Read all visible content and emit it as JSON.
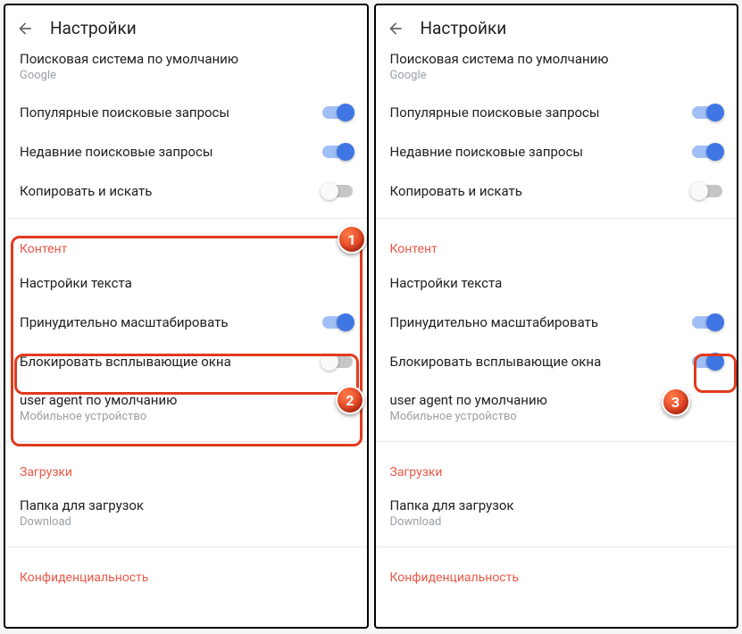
{
  "toolbar": {
    "title": "Настройки"
  },
  "search_engine": {
    "title": "Поисковая система по умолчанию",
    "value": "Google"
  },
  "popular_queries": {
    "label": "Популярные поисковые запросы",
    "on": true
  },
  "recent_queries": {
    "label": "Недавние поисковые запросы",
    "on": true
  },
  "copy_search": {
    "label": "Копировать и искать",
    "on": false
  },
  "section_content": "Контент",
  "text_settings": {
    "label": "Настройки текста"
  },
  "force_zoom": {
    "label": "Принудительно масштабировать",
    "on": true
  },
  "block_popups": {
    "label": "Блокировать всплывающие окна",
    "left_on": false,
    "right_on": true
  },
  "user_agent": {
    "label": "user agent по умолчанию",
    "value": "Мобильное устройство"
  },
  "section_downloads": "Загрузки",
  "download_folder": {
    "label": "Папка для загрузок",
    "value": "Download"
  },
  "section_privacy": "Конфиденциальность",
  "markers": {
    "m1": "1",
    "m2": "2",
    "m3": "3"
  }
}
